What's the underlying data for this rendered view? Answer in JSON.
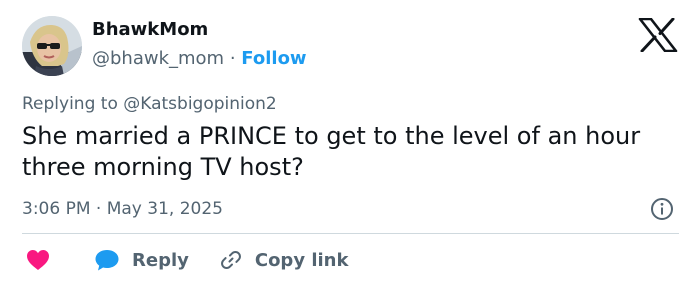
{
  "author": {
    "name": "BhawkMom",
    "handle": "@bhawk_mom",
    "separator": "·",
    "follow_label": "Follow"
  },
  "reply_context": {
    "prefix": "Replying to",
    "target": "@Katsbigopinion2"
  },
  "tweet": {
    "text": "She married a PRINCE to get to the level of an hour three morning TV host?"
  },
  "meta": {
    "time": "3:06 PM",
    "separator": "·",
    "date": "May 31, 2025"
  },
  "actions": {
    "reply_label": "Reply",
    "copy_link_label": "Copy link"
  },
  "icons": {
    "logo": "x-logo-icon",
    "info": "info-icon",
    "like": "heart-icon",
    "reply": "speech-bubble-icon",
    "copy": "link-icon"
  },
  "colors": {
    "accent": "#1d9bf0",
    "like": "#f91880",
    "text": "#0f1419",
    "muted": "#536471",
    "divider": "#cfd9de"
  }
}
